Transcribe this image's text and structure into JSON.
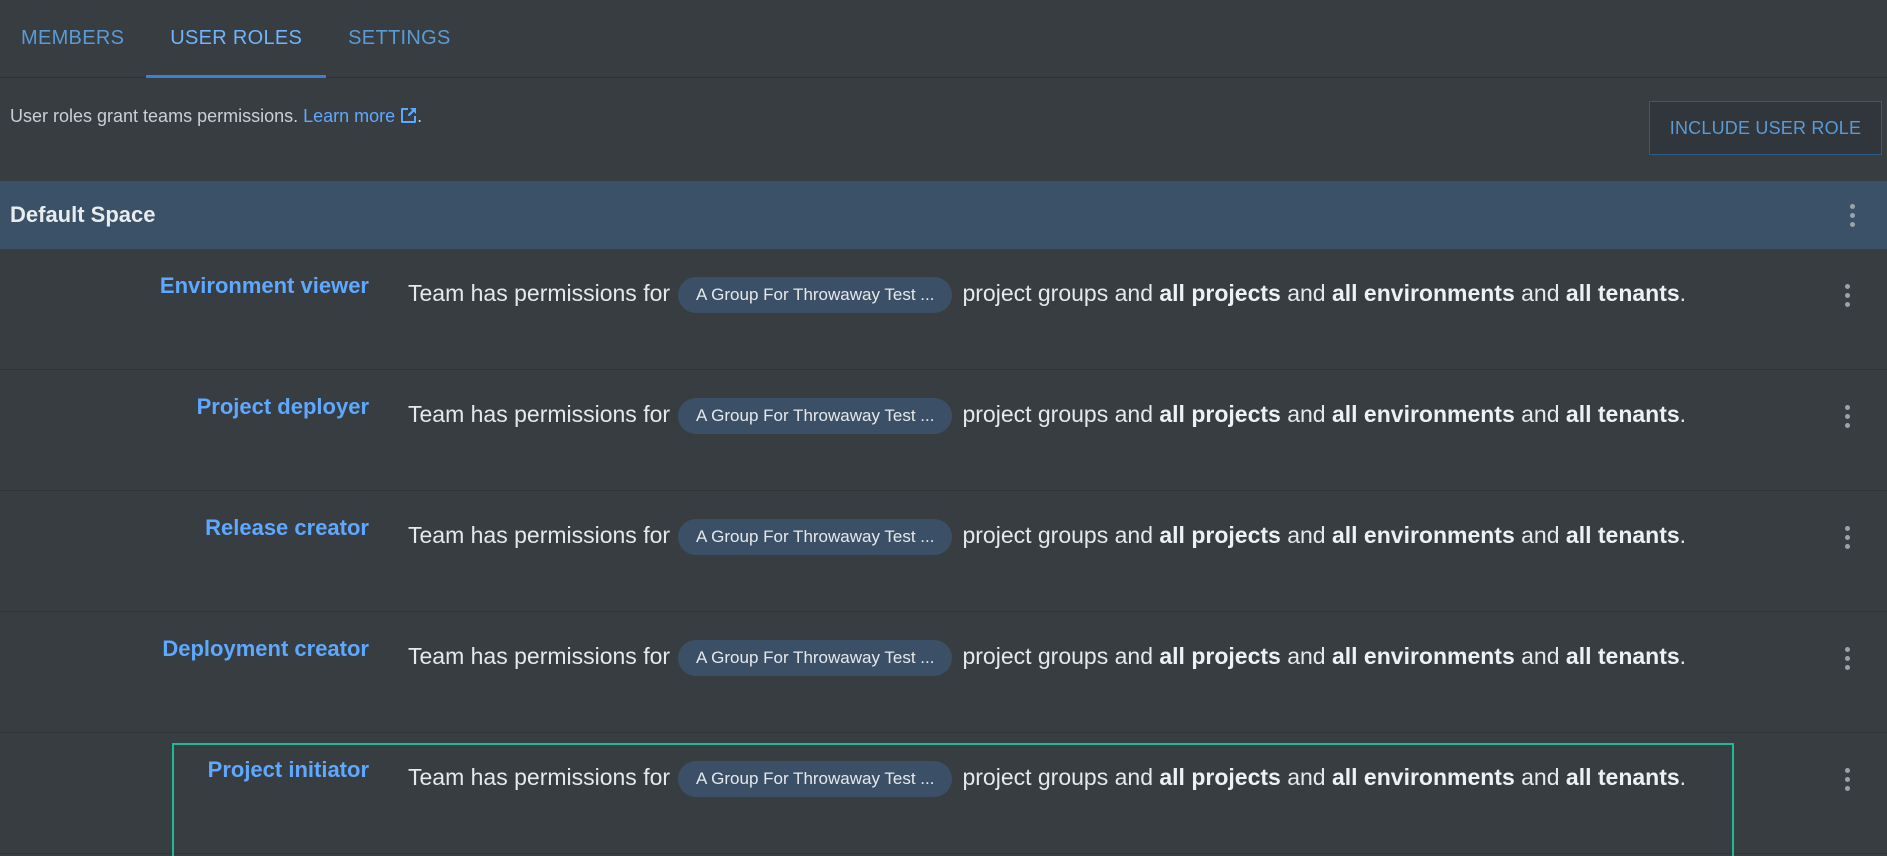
{
  "tabs": [
    {
      "label": "MEMBERS"
    },
    {
      "label": "USER ROLES"
    },
    {
      "label": "SETTINGS"
    }
  ],
  "intro": {
    "text": "User roles grant teams permissions. ",
    "link": "Learn more",
    "suffix": "."
  },
  "include_button": "INCLUDE USER ROLE",
  "space": {
    "title": "Default Space"
  },
  "desc": {
    "prefix": "Team has permissions for",
    "chip": "A Group For Throwaway Test ...",
    "mid": "project groups and",
    "b1": "all projects",
    "and1": "and",
    "b2": "all environments",
    "and2": "and",
    "b3a": "all",
    "b3b": "tenants",
    "end": "."
  },
  "roles": [
    {
      "name": "Environment viewer"
    },
    {
      "name": "Project deployer"
    },
    {
      "name": "Release creator"
    },
    {
      "name": "Deployment creator"
    },
    {
      "name": "Project initiator"
    }
  ],
  "colors": {
    "background": "#373d41",
    "accent": "#5ea8ff",
    "space_header": "#3a5168",
    "chip": "#3b5067",
    "highlight": "#1fb99a"
  },
  "icons": {
    "external_link": "external-link-icon",
    "more": "more-vertical-icon"
  }
}
